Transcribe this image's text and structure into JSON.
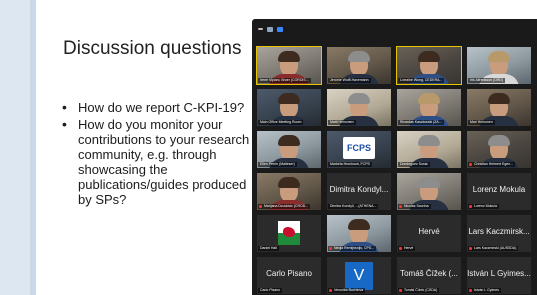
{
  "slide": {
    "title": "Discussion questions",
    "bullets": [
      "How do we report C-KPI-19?",
      "How do you monitor your contributions to your research community, e.g. through showcasing the publications/guides produced by SPs?"
    ]
  },
  "zoom": {
    "tiles": [
      {
        "label": "Irene Vipiani, Broer (CORDIS...",
        "type": "video",
        "muted": false
      },
      {
        "label": "Jerome Wolff-Havemann",
        "type": "video",
        "muted": false
      },
      {
        "label": "Lorraine Wong, CEDERA...",
        "type": "video",
        "muted": false
      },
      {
        "label": "Iris Alfredsson (ORD)",
        "type": "video",
        "muted": false
      },
      {
        "label": "Main Office Meeting Room",
        "type": "video",
        "muted": false
      },
      {
        "label": "Matti Heinonen",
        "type": "video",
        "muted": false
      },
      {
        "label": "Ricardas Kaszlowski (ZA...",
        "type": "video",
        "muted": false
      },
      {
        "label": "Mari Heinonen",
        "type": "video",
        "muted": false
      },
      {
        "label": "Ellen Perrin (Malteser)",
        "type": "video",
        "muted": false
      },
      {
        "label": "Markéta Hronková, FCPS",
        "type": "logo",
        "logo_text": "FCPS",
        "muted": false
      },
      {
        "label": "Dominguez Sosta",
        "type": "video",
        "muted": false
      },
      {
        "label": "Christian Helmert Egen...",
        "type": "video",
        "muted": true
      },
      {
        "label": "Marijana Dzudovic (CROD...",
        "type": "video",
        "muted": true
      },
      {
        "name": "Dimitra Kondyl...",
        "label": "Dimitra Kondyli, ...(ATHENA...",
        "type": "name",
        "muted": false
      },
      {
        "label": "Nicolas Saurina",
        "type": "video",
        "muted": true
      },
      {
        "name": "Lorenz Mokula",
        "label": "Lorenz Mokula",
        "type": "name",
        "muted": true
      },
      {
        "label": "Daniel Hall",
        "type": "flag",
        "muted": false
      },
      {
        "label": "Nedja Remijnsnijs, CPS...",
        "type": "video",
        "muted": true
      },
      {
        "name": "Hervé",
        "label": "Hervé",
        "type": "name",
        "muted": true
      },
      {
        "name": "Lars Kaczmirsk...",
        "label": "Lars Kaczmirski (AUSSDA)",
        "type": "name",
        "muted": true
      },
      {
        "name": "Carlo Pisano",
        "label": "Carlo Pisano",
        "type": "name",
        "muted": false
      },
      {
        "label": "Veronika Buchtova",
        "type": "avatar",
        "avatar_letter": "V",
        "muted": true
      },
      {
        "name": "Tomáš Čížek (...",
        "label": "Tomáš Čížek (CSDA)",
        "type": "name",
        "muted": true
      },
      {
        "name": "István L Gyimes...",
        "label": "István L Gyimes",
        "type": "name",
        "muted": true
      }
    ]
  },
  "colors": {
    "zoom_bg": "#1a1a1a",
    "slide_band": "#dce7f1",
    "speaker_border": "#e6c400",
    "mute_red": "#e53935",
    "avatar_blue": "#1769c5"
  },
  "icons": [
    "minimize-icon",
    "layout-icon",
    "grid-view-icon",
    "muted-microphone-icon",
    "welsh-flag-icon"
  ]
}
